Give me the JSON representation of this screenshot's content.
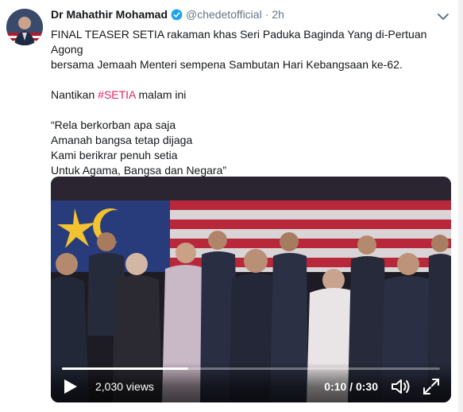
{
  "tweet": {
    "author_name": "Dr Mahathir Mohamad",
    "handle": "@chedetofficial",
    "separator": "·",
    "time": "2h",
    "text_line1": "FINAL TEASER SETIA rakaman khas Seri Paduka Baginda Yang di-Pertuan Agong",
    "text_line2": "bersama Jemaah Menteri sempena Sambutan Hari Kebangsaan ke-62.",
    "text_line3_prefix": "Nantikan ",
    "hashtag": "#SETIA",
    "text_line3_suffix": " malam ini",
    "quote_line1": "“Rela berkorban apa saja",
    "quote_line2": "Amanah bangsa tetap dijaga",
    "quote_line3": "Kami berikrar penuh setia",
    "quote_line4": "Untuk Agama, Bangsa dan Negara”"
  },
  "video": {
    "views": "2,030 views",
    "timecode": "0:10 / 0:30",
    "progress": 0.333
  },
  "icons": {
    "verified": "verified-badge-icon",
    "caret": "chevron-down-icon",
    "play": "play-icon",
    "volume": "volume-icon",
    "fullscreen": "fullscreen-icon"
  },
  "colors": {
    "verified": "#1da1f2",
    "hashtag": "#e0245e",
    "secondary_text": "#657786"
  }
}
